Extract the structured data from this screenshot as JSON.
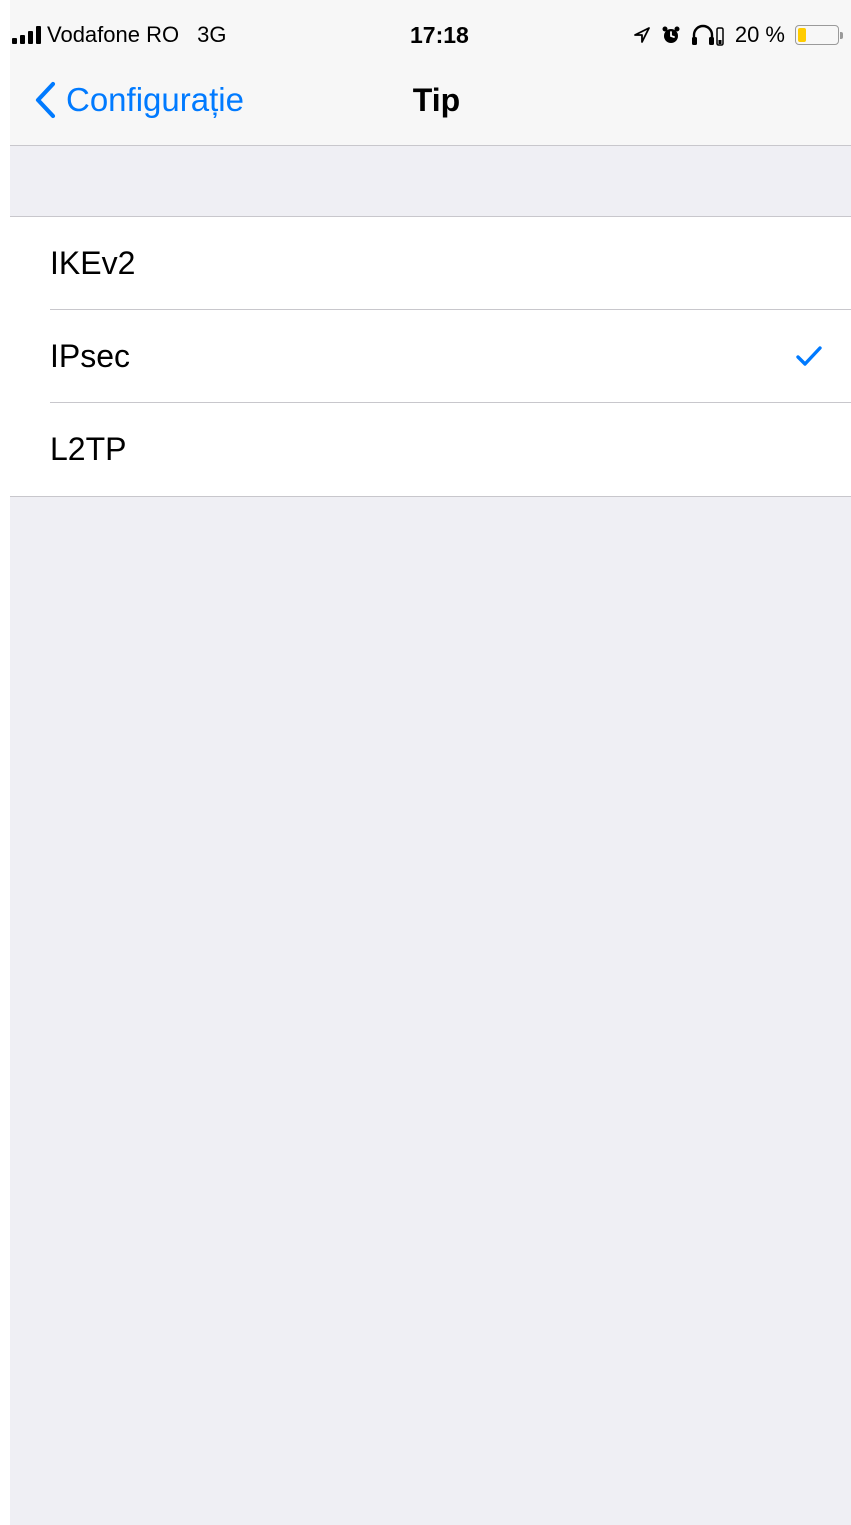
{
  "status_bar": {
    "carrier": "Vodafone RO",
    "network": "3G",
    "time": "17:18",
    "battery_percent": "20 %",
    "battery_level": 0.2,
    "icons": [
      "signal-icon",
      "location-arrow-icon",
      "alarm-clock-icon",
      "headphones-icon",
      "battery-icon"
    ]
  },
  "nav": {
    "back_label": "Configurație",
    "title": "Tip"
  },
  "options": [
    {
      "label": "IKEv2",
      "selected": false
    },
    {
      "label": "IPsec",
      "selected": true
    },
    {
      "label": "L2TP",
      "selected": false
    }
  ],
  "colors": {
    "accent": "#007aff",
    "background": "#efeff4",
    "bar": "#f7f7f7",
    "separator": "#c8c7cc",
    "battery_low": "#ffcc00"
  }
}
